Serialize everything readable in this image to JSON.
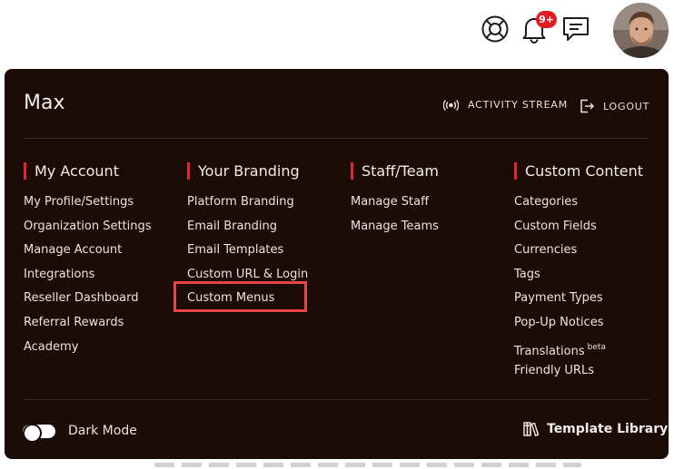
{
  "topbar": {
    "notification_badge": "9+",
    "icons": [
      "lifebuoy-icon",
      "bell-icon",
      "chat-icon"
    ]
  },
  "panel": {
    "user_name": "Max",
    "activity_stream_label": "ACTIVITY STREAM",
    "logout_label": "LOGOUT",
    "columns": [
      {
        "heading": "My Account",
        "items": [
          "My Profile/Settings",
          "Organization Settings",
          "Manage Account",
          "Integrations",
          "Reseller Dashboard",
          "Referral Rewards",
          "Academy"
        ]
      },
      {
        "heading": "Your Branding",
        "items": [
          "Platform Branding",
          "Email Branding",
          "Email Templates",
          "Custom URL & Login",
          "Custom Menus"
        ]
      },
      {
        "heading": "Staff/Team",
        "items": [
          "Manage Staff",
          "Manage Teams"
        ]
      },
      {
        "heading": "Custom Content",
        "items": [
          "Categories",
          "Custom Fields",
          "Currencies",
          "Tags",
          "Payment Types",
          "Pop-Up Notices",
          "Translations",
          "Friendly URLs"
        ],
        "translations_badge": "beta"
      }
    ],
    "dark_mode_label": "Dark Mode",
    "dark_mode_on": false,
    "template_library_label": "Template Library"
  },
  "colors": {
    "panel_bg": "#1c0c07",
    "accent_red": "#e0282e",
    "highlight_box": "#e8444a",
    "badge_red": "#e01b24"
  }
}
